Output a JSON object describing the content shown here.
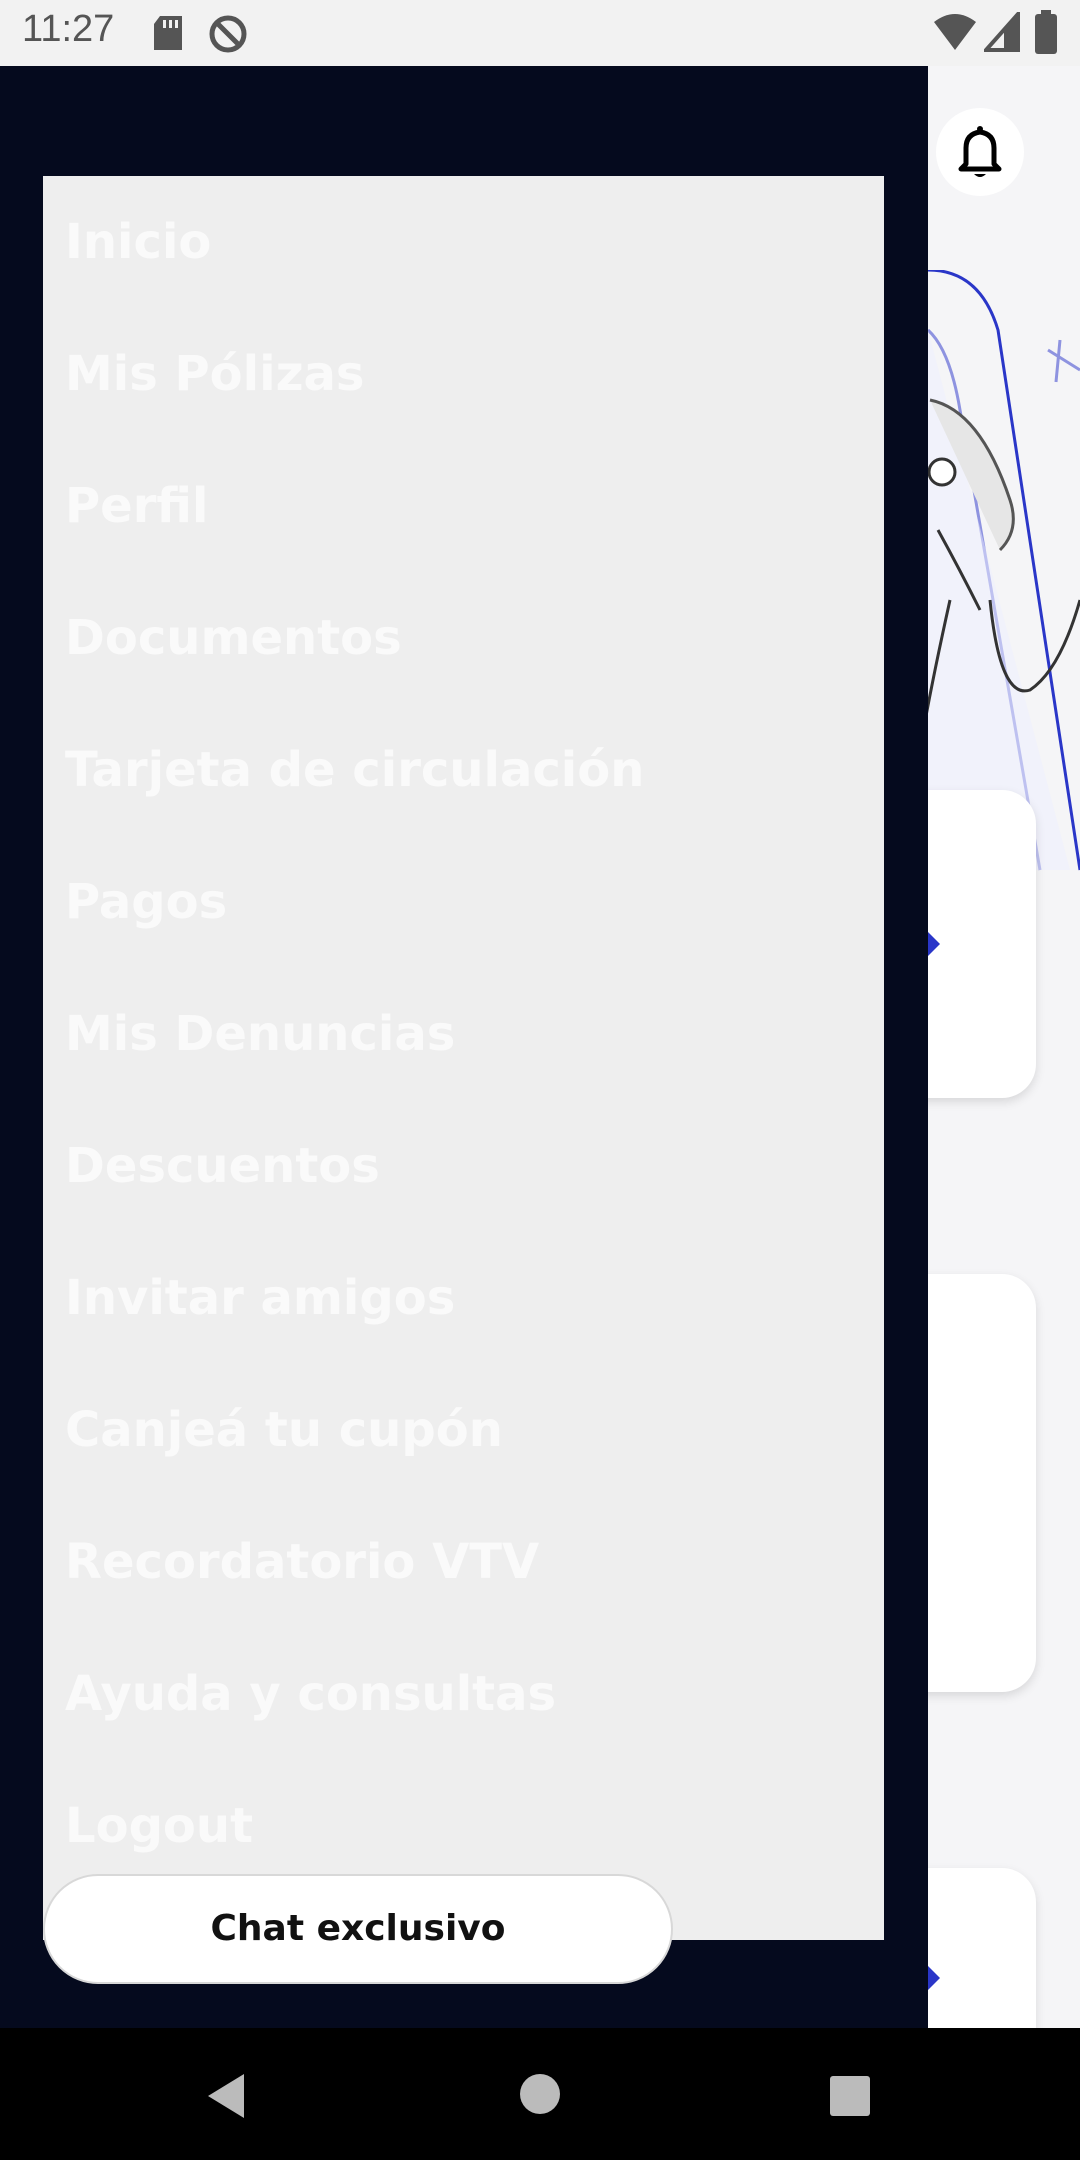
{
  "status_bar": {
    "time": "11:27",
    "icons": [
      "sd-card-icon",
      "no-location-icon",
      "wifi-icon",
      "cell-signal-icon",
      "battery-icon"
    ]
  },
  "drawer": {
    "menu_items": [
      "Inicio",
      "Mis Pólizas",
      "Perfil",
      "Documentos",
      "Tarjeta de circulación",
      "Pagos",
      "Mis Denuncias",
      "Descuentos",
      "Invitar amigos",
      "Canjeá tu cupón",
      "Recordatorio VTV",
      "Ayuda y consultas",
      "Logout"
    ],
    "chat_button_label": "Chat exclusivo"
  },
  "background": {
    "accent_color": "#2a36c8",
    "icons": [
      "bell-icon",
      "play-arrow-icon"
    ]
  },
  "nav_bar": {
    "icons": [
      "back-icon",
      "home-icon",
      "recents-icon"
    ]
  }
}
